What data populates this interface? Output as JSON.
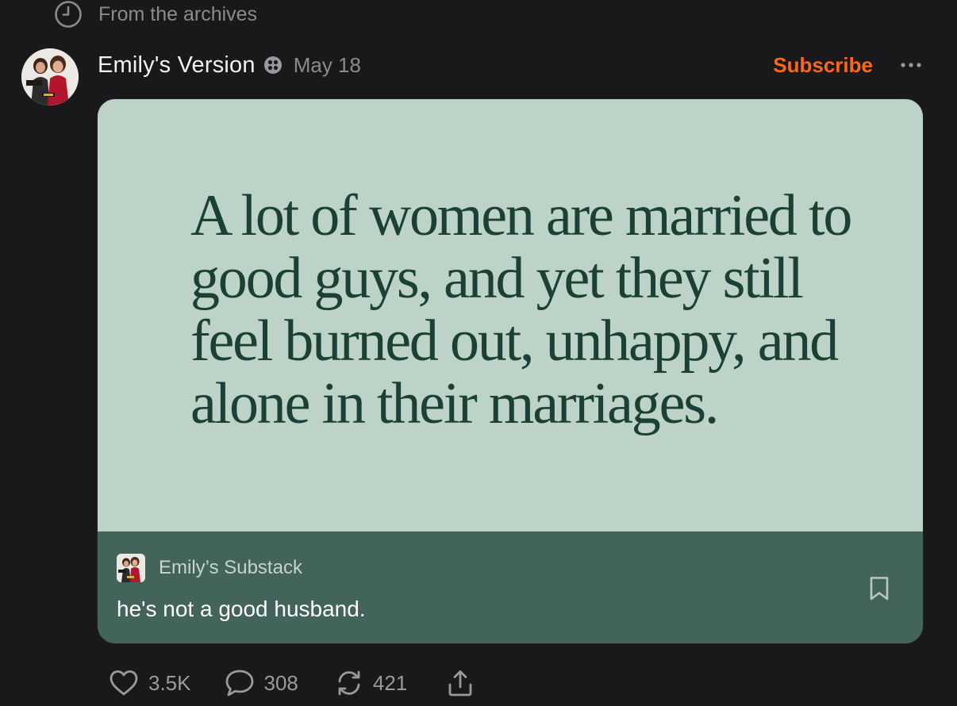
{
  "archive": {
    "label": "From the archives",
    "icon": "clock-icon"
  },
  "post": {
    "author": "Emily's Version",
    "author_badge_icon": "publication-badge-icon",
    "date": "May 18",
    "subscribe_label": "Subscribe",
    "more_icon": "more-horizontal-icon",
    "image_quote": "A lot of women are married to good guys, and yet they still feel burned out, unhappy, and alone in their marriages.",
    "publication_name": "Emily’s Substack",
    "title": "he's not a good husband.",
    "bookmark_icon": "bookmark-icon"
  },
  "actions": {
    "likes": "3.5K",
    "comments": "308",
    "restacks": "421",
    "share_icon": "share-icon"
  },
  "colors": {
    "background": "#19191b",
    "accent": "#ff6719",
    "card_image": "#bdd3c8",
    "card_footer": "#42645b",
    "quote_text": "#1b4136"
  }
}
